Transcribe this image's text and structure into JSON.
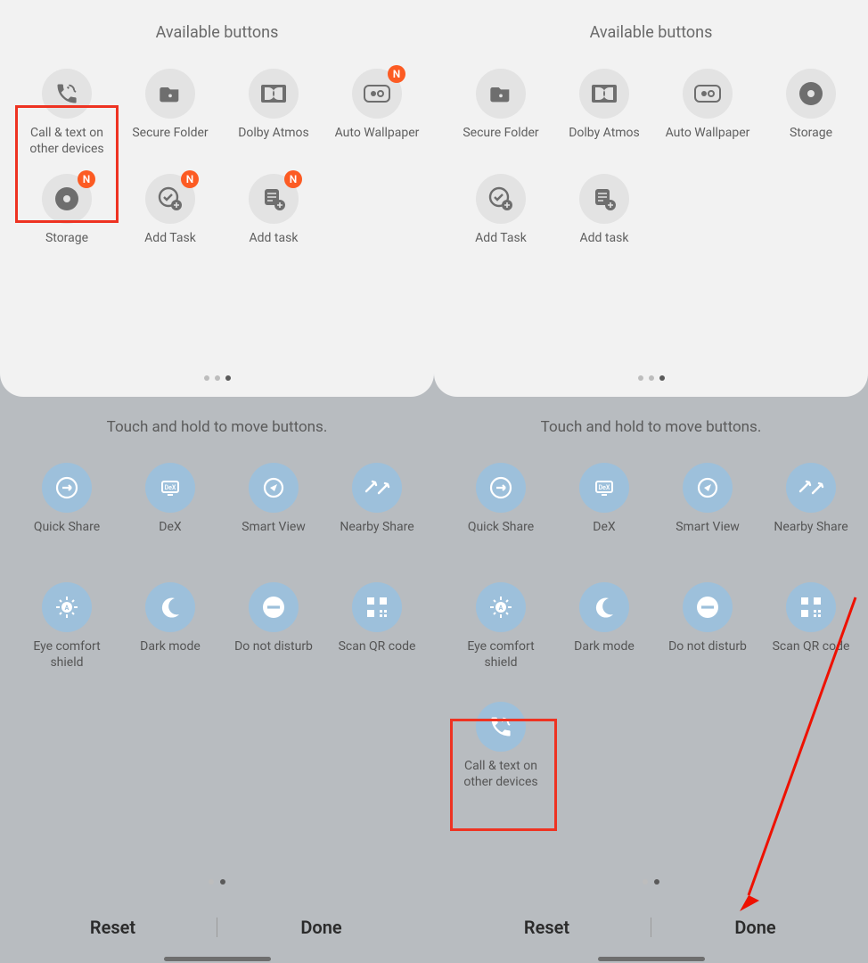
{
  "section_title": "Available buttons",
  "hint": "Touch and hold to move buttons.",
  "badge": "N",
  "bottom": {
    "reset": "Reset",
    "done": "Done"
  },
  "left": {
    "avail": [
      {
        "label": "Call & text on other devices",
        "icon": "phone-sync"
      },
      {
        "label": "Secure Folder",
        "icon": "folder-lock"
      },
      {
        "label": "Dolby Atmos",
        "icon": "dolby"
      },
      {
        "label": "Auto Wallpaper",
        "icon": "wallpaper",
        "badge": true
      },
      {
        "label": "Storage",
        "icon": "disc",
        "badge": true
      },
      {
        "label": "Add Task",
        "icon": "task-check",
        "badge": true
      },
      {
        "label": "Add task",
        "icon": "task-stack",
        "badge": true
      }
    ]
  },
  "right": {
    "avail": [
      {
        "label": "Secure Folder",
        "icon": "folder-lock"
      },
      {
        "label": "Dolby Atmos",
        "icon": "dolby"
      },
      {
        "label": "Auto Wallpaper",
        "icon": "wallpaper"
      },
      {
        "label": "Storage",
        "icon": "disc"
      },
      {
        "label": "Add Task",
        "icon": "task-check"
      },
      {
        "label": "Add task",
        "icon": "task-stack"
      }
    ],
    "row3": {
      "label": "Call & text on other devices",
      "icon": "phone-sync-blue"
    }
  },
  "active": [
    {
      "label": "Quick Share",
      "icon": "quick-share"
    },
    {
      "label": "DeX",
      "icon": "dex"
    },
    {
      "label": "Smart View",
      "icon": "smart-view"
    },
    {
      "label": "Nearby Share",
      "icon": "nearby"
    },
    {
      "label": "Eye comfort shield",
      "icon": "eye-comfort"
    },
    {
      "label": "Dark mode",
      "icon": "moon"
    },
    {
      "label": "Do not disturb",
      "icon": "dnd"
    },
    {
      "label": "Scan QR code",
      "icon": "qr"
    }
  ]
}
